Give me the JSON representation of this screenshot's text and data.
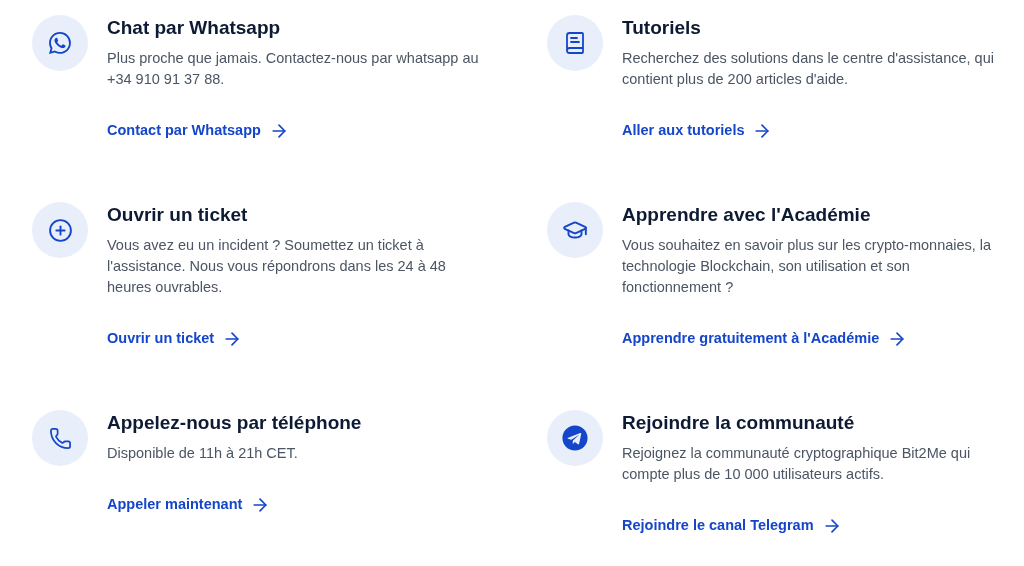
{
  "cards": [
    {
      "kind": "whatsapp",
      "title": "Chat par Whatsapp",
      "description": "Plus proche que jamais. Contactez-nous par whatsapp au +34 910 91 37 88.",
      "link": "Contact par Whatsapp"
    },
    {
      "kind": "book",
      "title": "Tutoriels",
      "description": "Recherchez des solutions dans le centre d'assistance, qui contient plus de 200 articles d'aide.",
      "link": "Aller aux tutoriels"
    },
    {
      "kind": "plus",
      "title": "Ouvrir un ticket",
      "description": "Vous avez eu un incident ? Soumettez un ticket à l'assistance. Nous vous répondrons dans les 24 à 48 heures ouvrables.",
      "link": "Ouvrir un ticket"
    },
    {
      "kind": "cap",
      "title": "Apprendre avec l'Académie",
      "description": "Vous souhaitez en savoir plus sur les crypto-monnaies, la technologie Blockchain, son utilisation et son fonctionnement ?",
      "link": "Apprendre gratuitement à l'Académie"
    },
    {
      "kind": "phone",
      "title": "Appelez-nous par téléphone",
      "description": "Disponible de 11h à 21h CET.",
      "link": "Appeler maintenant"
    },
    {
      "kind": "telegram",
      "title": "Rejoindre la communauté",
      "description": "Rejoignez la communauté cryptographique Bit2Me qui compte plus de 10 000 utilisateurs actifs.",
      "link": "Rejoindre le canal Telegram"
    }
  ]
}
